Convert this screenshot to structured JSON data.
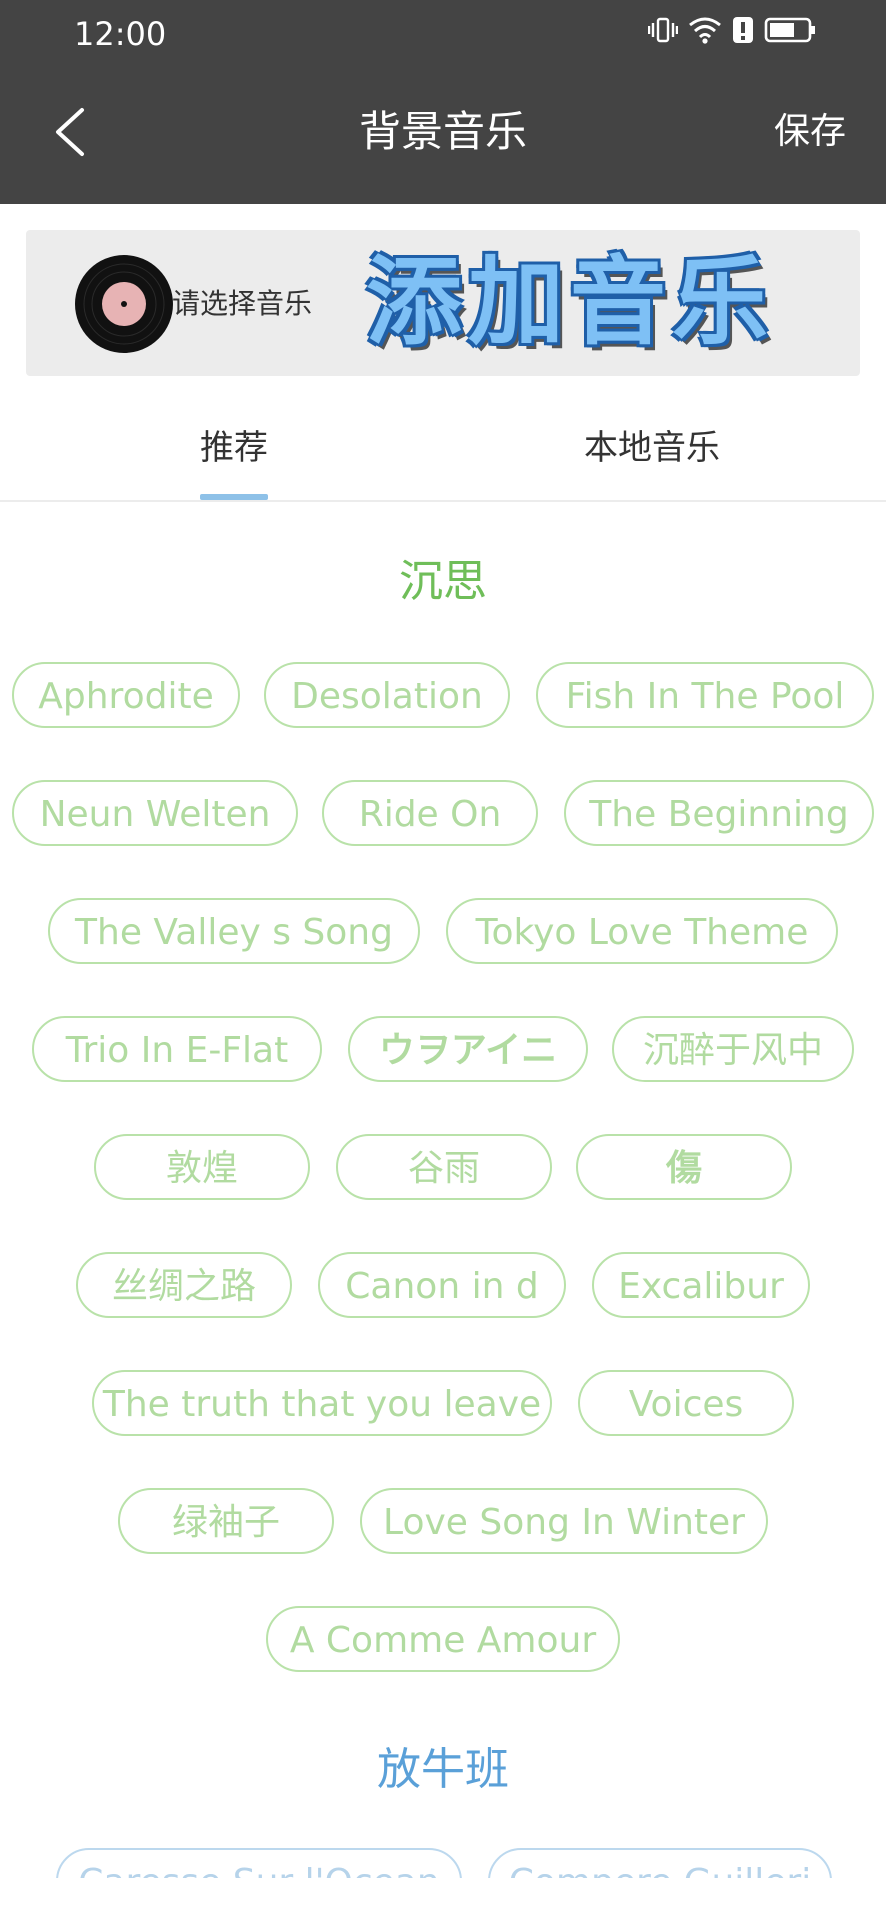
{
  "status_bar": {
    "time": "12:00"
  },
  "header": {
    "title": "背景音乐",
    "save_label": "保存"
  },
  "banner": {
    "hint": "请选择音乐",
    "add_label": "添加音乐"
  },
  "tabs": [
    {
      "label": "推荐",
      "selected": true
    },
    {
      "label": "本地音乐",
      "selected": false
    }
  ],
  "sections": [
    {
      "title": "沉思",
      "items": [
        "Aphrodite",
        "Desolation",
        "Fish In The Pool",
        "Neun Welten",
        "Ride On",
        "The Beginning",
        "The Valley s Song",
        "Tokyo Love Theme",
        "Trio In E-Flat",
        "ウヲアイニ",
        "沉醉于风中",
        "敦煌",
        "谷雨",
        "傷",
        "丝绸之路",
        "Canon in d",
        "Excalibur",
        "The truth that you leave",
        "Voices",
        "绿袖子",
        "Love Song In Winter",
        "A Comme Amour"
      ]
    },
    {
      "title": "放牛班",
      "items": [
        "Caresse Sur l'Ocean",
        "Compere Guilleri"
      ]
    }
  ],
  "colors": {
    "header_bg": "#444444",
    "green_chip": "#b1dba0",
    "green_title": "#6fbe59",
    "blue_title": "#5aa0d8",
    "tab_indicator": "#8ec1e8"
  }
}
